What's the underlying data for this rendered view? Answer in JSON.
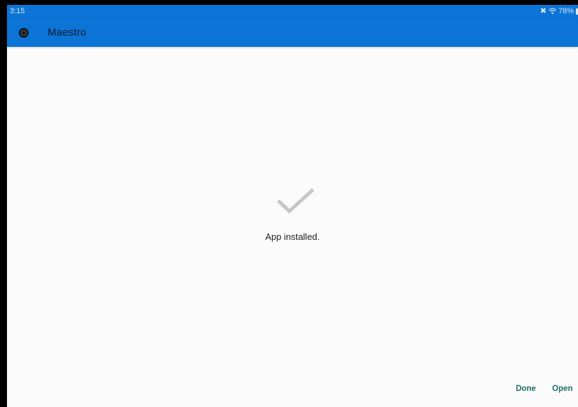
{
  "status_bar": {
    "time": "3:15",
    "battery": "78%",
    "icons": [
      "mute-icon",
      "wifi-icon",
      "battery-icon"
    ]
  },
  "app_bar": {
    "title": "Maestro",
    "icon": "maestro-app-icon"
  },
  "installer": {
    "status_icon": "checkmark-icon",
    "message": "App installed."
  },
  "actions": {
    "done_label": "Done",
    "open_label": "Open"
  },
  "colors": {
    "app_bar": "#0b74d6",
    "background": "#fbfbfb",
    "checkmark": "#c6c6c6",
    "action_text": "#1f6f68"
  }
}
